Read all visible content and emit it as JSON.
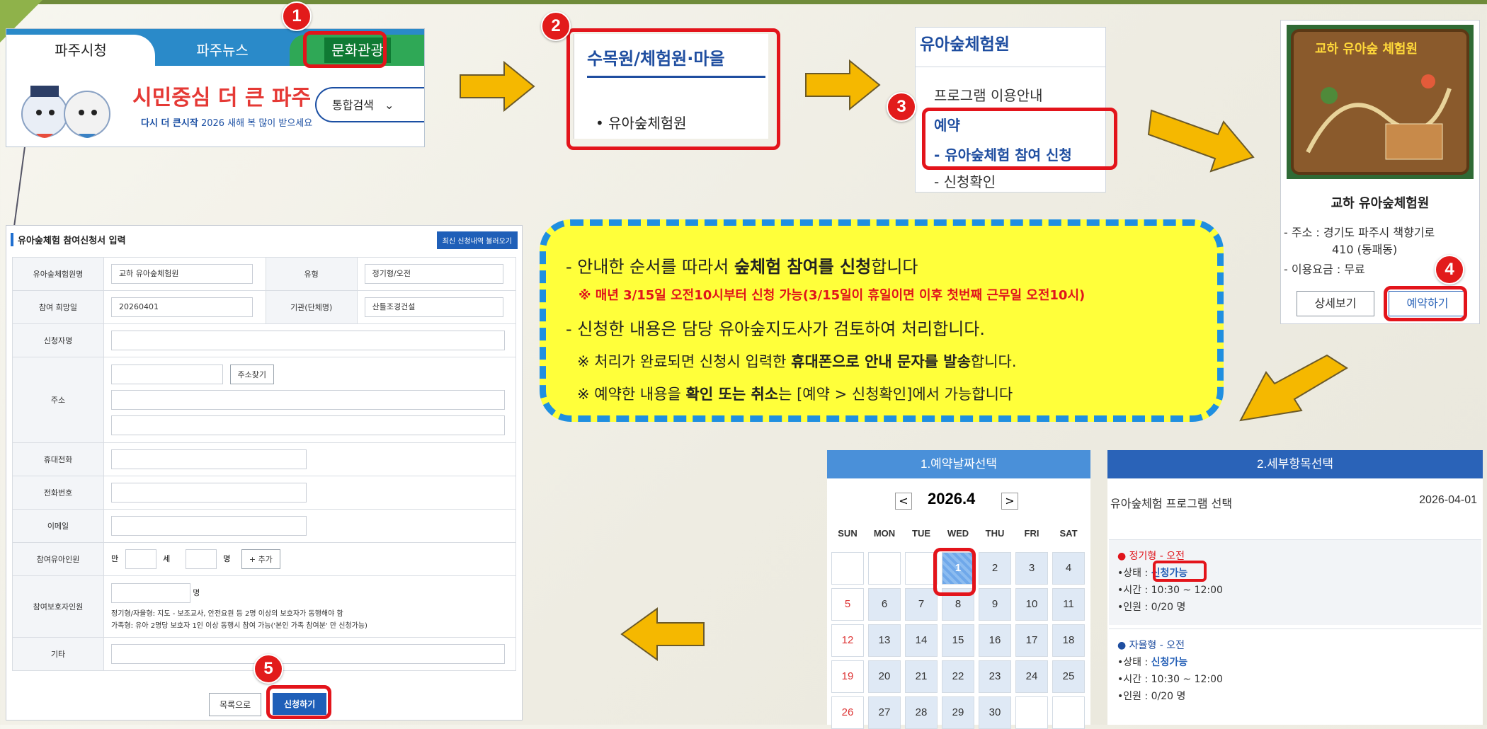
{
  "steps": {
    "s1": "1",
    "s2": "2",
    "s3": "3",
    "s4": "4",
    "s5": "5"
  },
  "panel1": {
    "tab1": "파주시청",
    "tab2": "파주뉴스",
    "tab3": "문화관광",
    "banner_main": "시민중심 더 큰 파주",
    "banner_sub_bold": "다시 더 큰시작",
    "banner_sub": "2026 새해 복 많이 받으세요",
    "search_label": "통합검색"
  },
  "panel2": {
    "title": "수목원/체험원·마을",
    "item": "유아숲체험원"
  },
  "panel3": {
    "title": "유아숲체험원",
    "item1": "프로그램 이용안내",
    "section": "예약",
    "item2": "- 유아숲체험 참여 신청",
    "item3": "- 신청확인"
  },
  "panel4": {
    "image_title": "교하 유아숲 체험원",
    "name": "교하 유아숲체험원",
    "address_label": "- 주소 : 경기도 파주시 책향기로",
    "address_2": "410 (동패동)",
    "fee": "- 이용요금 : 무료",
    "detail_btn": "상세보기",
    "reserve_btn": "예약하기"
  },
  "notice": {
    "l1_pre": "- 안내한 순서를 따라서 ",
    "l1_bold": "숲체험 참여를 신청",
    "l1_post": "합니다",
    "l2": "※ 매년 3/15일 오전10시부터 신청 가능(3/15일이 휴일이면 이후 첫번째 근무일 오전10시)",
    "l3": "- 신청한 내용은 담당 유아숲지도사가 검토하여 처리합니다.",
    "l4_pre": "※ 처리가 완료되면 신청시 입력한 ",
    "l4_bold": "휴대폰으로 안내 문자를 발송",
    "l4_post": "합니다.",
    "l5_pre": "※ 예약한 내용을 ",
    "l5_bold": "확인 또는 취소",
    "l5_post": "는 [예약 > 신청확인]에서 가능합니다"
  },
  "calendar": {
    "header": "1.예약날짜선택",
    "month": "2026.4",
    "prev": "<",
    "next": ">",
    "dow": [
      "SUN",
      "MON",
      "TUE",
      "WED",
      "THU",
      "FRI",
      "SAT"
    ],
    "weeks": [
      [
        "",
        "",
        "",
        "1",
        "2",
        "3",
        "4"
      ],
      [
        "5",
        "6",
        "7",
        "8",
        "9",
        "10",
        "11"
      ],
      [
        "12",
        "13",
        "14",
        "15",
        "16",
        "17",
        "18"
      ],
      [
        "19",
        "20",
        "21",
        "22",
        "23",
        "24",
        "25"
      ],
      [
        "26",
        "27",
        "28",
        "29",
        "30",
        "",
        ""
      ]
    ]
  },
  "detail": {
    "header": "2.세부항목선택",
    "label": "유아숲체험 프로그램 선택",
    "date": "2026-04-01",
    "card1": {
      "title": "● 정기형 - 오전",
      "status_label": "•상태 : ",
      "status": "신청가능",
      "time": "•시간 : 10:30 ~ 12:00",
      "people": "•인원 : 0/20 명"
    },
    "card2": {
      "title": "● 자율형 - 오전",
      "status_label": "•상태 : ",
      "status": "신청가능",
      "time": "•시간 : 10:30 ~ 12:00",
      "people": "•인원 : 0/20 명"
    }
  },
  "form": {
    "title": "유아숲체험 참여신청서 입력",
    "load_btn": "최신 신청내역 불러오기",
    "row1": {
      "label": "유아숲체험원명",
      "value": "교하 유아숲체험원",
      "label2": "유형",
      "value2": "정기형/오전"
    },
    "row2": {
      "label": "참여 희망일",
      "value": "20260401",
      "label2": "기관(단체명)",
      "value2": "산틀조경건설"
    },
    "applicant": "신청자명",
    "address": "주소",
    "address_btn": "주소찾기",
    "mobile": "휴대전화",
    "phone": "전화번호",
    "email": "이메일",
    "children": {
      "label": "참여유아인원",
      "age_pre": "만",
      "age_unit": "세",
      "count_unit": "명",
      "add_btn": "+ 추가"
    },
    "guardian": {
      "label": "참여보호자인원",
      "unit": "명",
      "note1": "정기형/자율형: 지도 - 보조교사, 안전요원 등 2명 이상의 보호자가 동행해야 함",
      "note2": "가족형: 유아 2명당 보호자 1인 이상 동행시 참여 가능('본인 가족 참여분' 만 신청가능)"
    },
    "etc": "기타",
    "list_btn": "목록으로",
    "submit_btn": "신청하기"
  },
  "colors": {
    "badge": "#e21b1b",
    "highlight_border": "#e3141b",
    "arrow": "#f5b800",
    "notice_bg": "#ffff3a",
    "notice_border": "#1f8fe0",
    "cal_head": "#4a90d9",
    "detail_head": "#2a63b8"
  }
}
